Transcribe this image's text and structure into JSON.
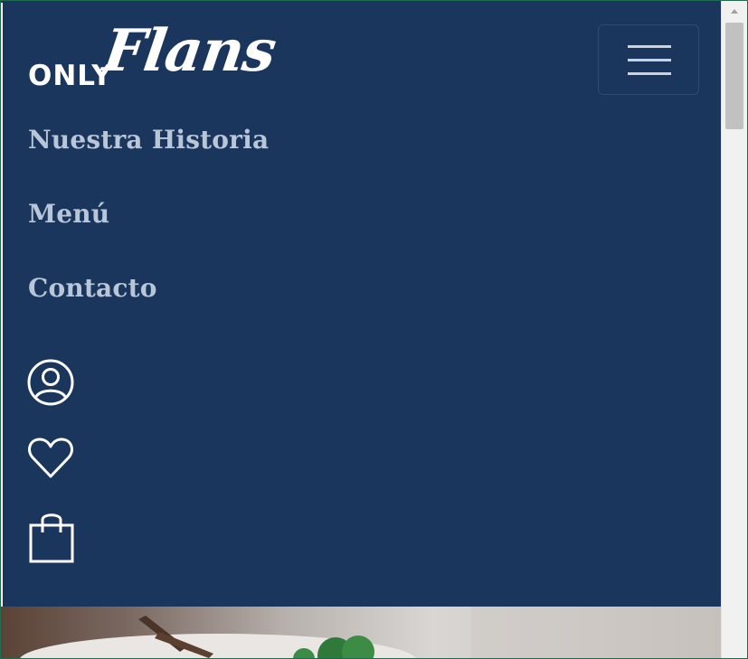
{
  "brand": {
    "prefix": "ONLY",
    "name": "Flans"
  },
  "navbar": {
    "toggler_icon": "hamburger-menu-icon",
    "links": [
      {
        "label": "Nuestra Historia"
      },
      {
        "label": "Menú"
      },
      {
        "label": "Contacto"
      }
    ],
    "icons": [
      {
        "name": "user-account-icon"
      },
      {
        "name": "heart-favorites-icon"
      },
      {
        "name": "shopping-bag-icon"
      }
    ]
  },
  "colors": {
    "navbar_bg": "#1a365c",
    "link_color": "#b9c6d8",
    "icon_color": "#ffffff"
  },
  "hero": {
    "image": "flan-dessert-photo"
  }
}
